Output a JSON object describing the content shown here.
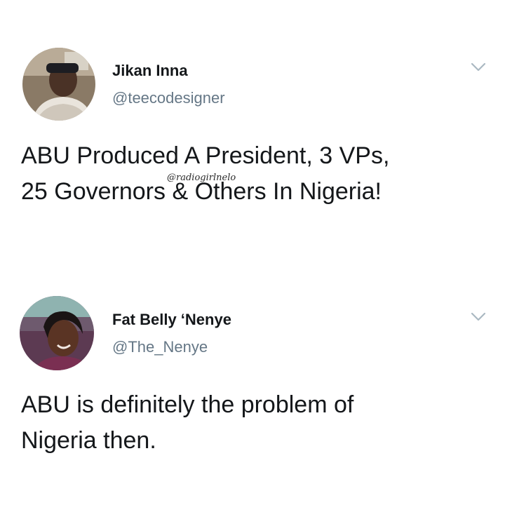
{
  "tweets": [
    {
      "display_name": "Jikan Inna",
      "handle": "@teecodesigner",
      "text": "ABU Produced A President, 3 VPs,\n25 Governors & Others In Nigeria!",
      "avatar_icon": "user-avatar",
      "menu_icon": "chevron-down-icon"
    },
    {
      "display_name": "Fat Belly ‘Nenye",
      "handle": "@The_Nenye",
      "text": "ABU is definitely the problem of\nNigeria then.",
      "avatar_icon": "user-avatar",
      "menu_icon": "chevron-down-icon"
    }
  ],
  "watermark": "@radiogirlnelo",
  "colors": {
    "name": "#14171a",
    "handle": "#657786",
    "caret": "#aab8c2",
    "background": "#ffffff"
  }
}
